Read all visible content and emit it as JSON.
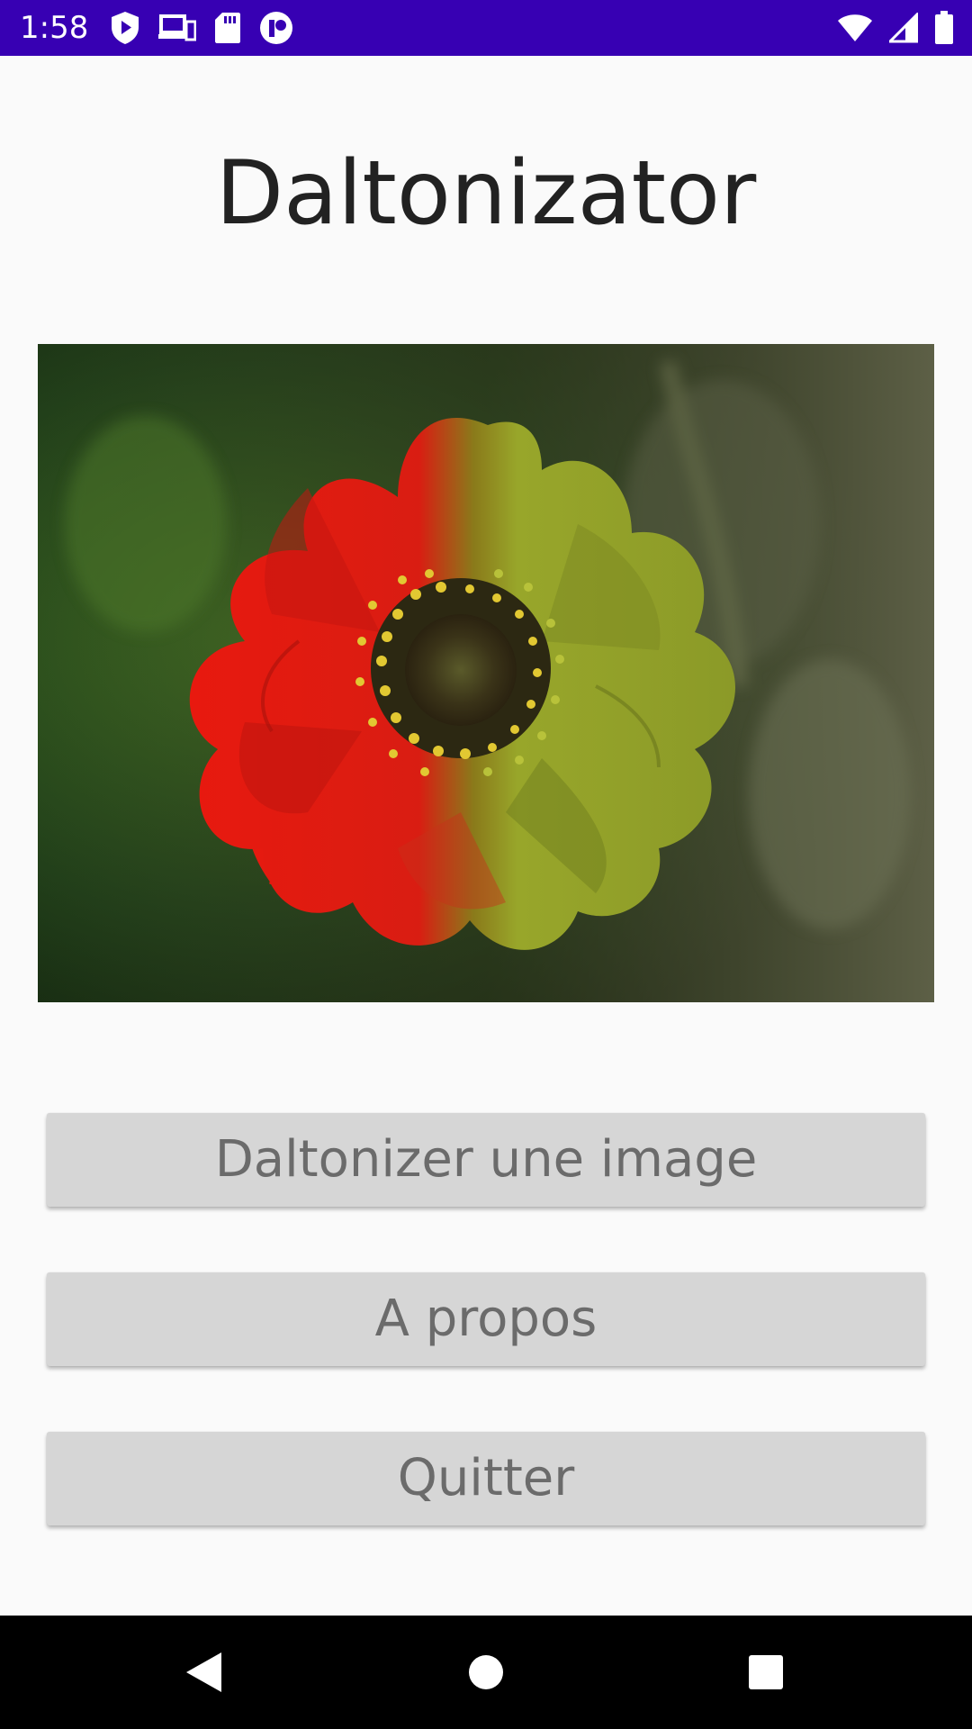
{
  "status_bar": {
    "time": "1:58",
    "background": "#3700b3",
    "left_icons": [
      "shield-play-icon",
      "devices-icon",
      "sd-card-icon",
      "circle-app-icon"
    ],
    "right_icons": [
      "wifi-icon",
      "signal-icon",
      "battery-icon"
    ]
  },
  "app": {
    "title": "Daltonizator"
  },
  "picture": {
    "subject": "flower-icon",
    "colors": {
      "red_half": "#e01a12",
      "green_half": "#9aa82a",
      "center": "#d8c23a"
    }
  },
  "buttons": {
    "daltonize": "Daltonizer une image",
    "about": "A propos",
    "quit": "Quitter"
  },
  "nav_bar": {
    "icons": [
      "back-icon",
      "home-icon",
      "recents-icon"
    ]
  }
}
